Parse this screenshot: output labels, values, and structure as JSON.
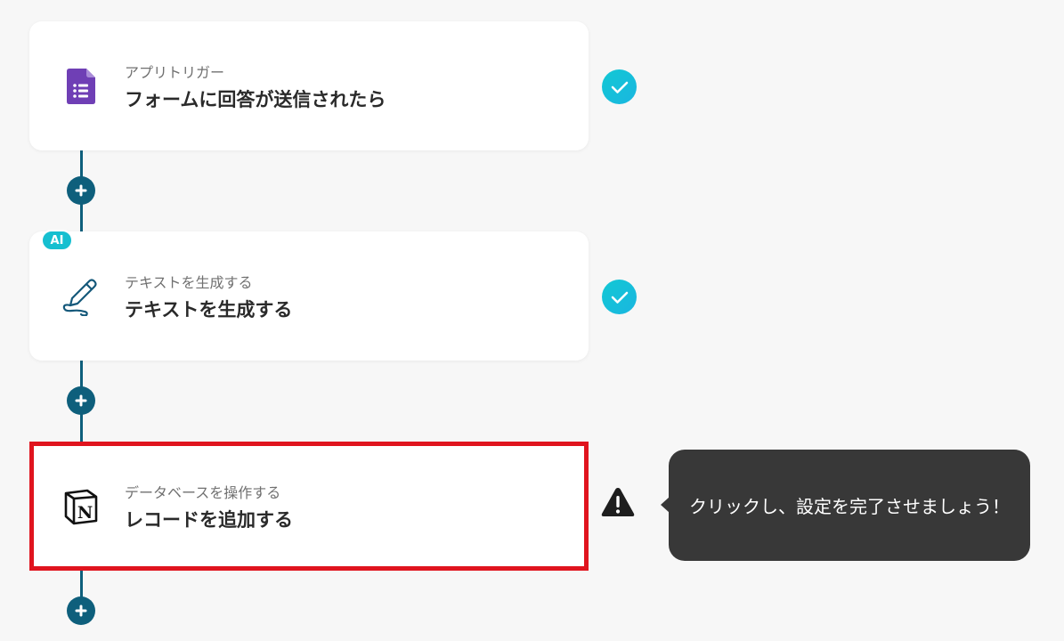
{
  "flow": {
    "steps": [
      {
        "subtitle": "アプリトリガー",
        "title": "フォームに回答が送信されたら",
        "icon": "google-forms-icon",
        "status": "complete",
        "badge": ""
      },
      {
        "subtitle": "テキストを生成する",
        "title": "テキストを生成する",
        "icon": "pen-icon",
        "status": "complete",
        "badge": "AI"
      },
      {
        "subtitle": "データベースを操作する",
        "title": "レコードを追加する",
        "icon": "notion-icon",
        "status": "warning",
        "badge": ""
      }
    ]
  },
  "tooltip": {
    "text": "クリックし、設定を完了させましょう！"
  },
  "colors": {
    "background": "#f7f7f7",
    "connector": "#0e5f7c",
    "check": "#16bfd0",
    "highlight_border": "#e0141e",
    "tooltip_bg": "#383838",
    "forms_purple": "#6f3fb5"
  }
}
